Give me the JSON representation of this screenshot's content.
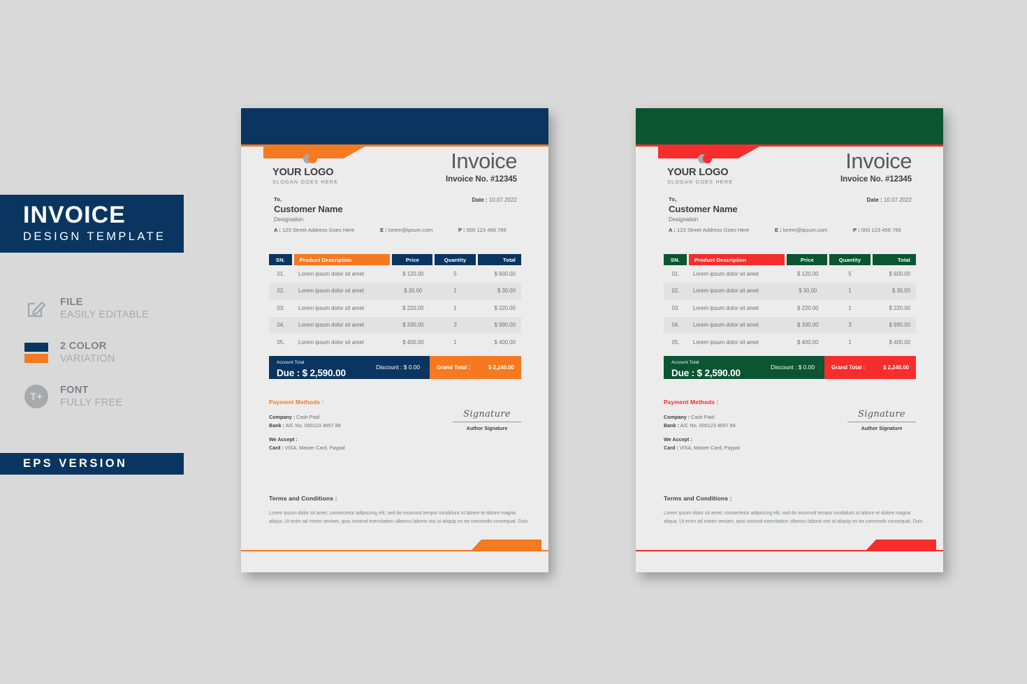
{
  "promo": {
    "title_line1": "INVOICE",
    "title_line2": "DESIGN TEMPLATE",
    "features": [
      {
        "icon": "edit-file-icon",
        "line1": "FILE",
        "line2": "EASILY EDITABLE"
      },
      {
        "icon": "color-swatch-icon",
        "line1": "2 COLOR",
        "line2": "VARIATION"
      },
      {
        "icon": "font-icon",
        "line1": "FONT",
        "line2": "FULLY FREE"
      }
    ],
    "eps_label": "EPS VERSION"
  },
  "colors": {
    "navy": "#0a3560",
    "orange": "#f47920",
    "green": "#0b5533",
    "red": "#f52d2d",
    "paper": "#ececec",
    "row_alt": "#e2e2e2",
    "page_bg": "#d9d9d9"
  },
  "invoice": {
    "logo_name": "YOUR LOGO",
    "logo_slogan": "SLOGAN GOES HERE",
    "title": "Invoice",
    "number_label": "Invoice No. #12345",
    "to_label": "To,",
    "customer_name": "Customer Name",
    "designation": "Designation",
    "date_label": "Date :",
    "date_value": "10.07.2022",
    "contact": {
      "address_label": "A :",
      "address_value": "123 Street Address Goes Here",
      "email_label": "E :",
      "email_value": "lorem@ipsum.com",
      "phone_label": "P :",
      "phone_value": "000 123 456 789"
    },
    "table": {
      "headers": [
        "SN.",
        "Product Description",
        "Price",
        "Quantity",
        "Total"
      ],
      "rows": [
        {
          "sn": "01.",
          "desc": "Lorem ipsum dolor sit amet",
          "price": "$ 120.00",
          "qty": "5",
          "total": "$ 600.00"
        },
        {
          "sn": "02.",
          "desc": "Lorem ipsum dolor sit amet",
          "price": "$ 30.00",
          "qty": "1",
          "total": "$ 30.00"
        },
        {
          "sn": "03.",
          "desc": "Lorem ipsum dolor sit amet",
          "price": "$ 220.00",
          "qty": "1",
          "total": "$ 220.00"
        },
        {
          "sn": "04.",
          "desc": "Lorem ipsum dolor sit amet",
          "price": "$ 330.00",
          "qty": "3",
          "total": "$ 990.00"
        },
        {
          "sn": "05.",
          "desc": "Lorem ipsum dolor sit amet",
          "price": "$ 400.00",
          "qty": "1",
          "total": "$ 400.00"
        }
      ]
    },
    "totals": {
      "account_total_label": "Account Total",
      "due_label": "Due : $ 2,590.00",
      "discount_label": "Discount : $ 0.00",
      "grand_total_label": "Grand Total :",
      "grand_total_value": "$ 2,240.00"
    },
    "payment": {
      "heading": "Payment Methods :",
      "company_label": "Company :",
      "company_value": "Cash Paid",
      "bank_label": "Bank :",
      "bank_value": "A/C No. 000123 4657 89",
      "accept_label": "We Accept :",
      "card_label": "Card :",
      "card_value": "VISA, Master Card, Paypal"
    },
    "signature": {
      "script": "Signature",
      "caption": "Author Signature"
    },
    "terms": {
      "heading": "Terms and Conditions :",
      "body": "Lorem ipsum dolor sit amet, consectetur adipiscing elit, sed do eiusmod tempor incididunt ut labore et dolore magna aliqua. Ut enim ad minim veniam, quis nostrud exercitation ullamco laboris nisi ut aliquip ex ea commodo consequat. Duis"
    }
  }
}
